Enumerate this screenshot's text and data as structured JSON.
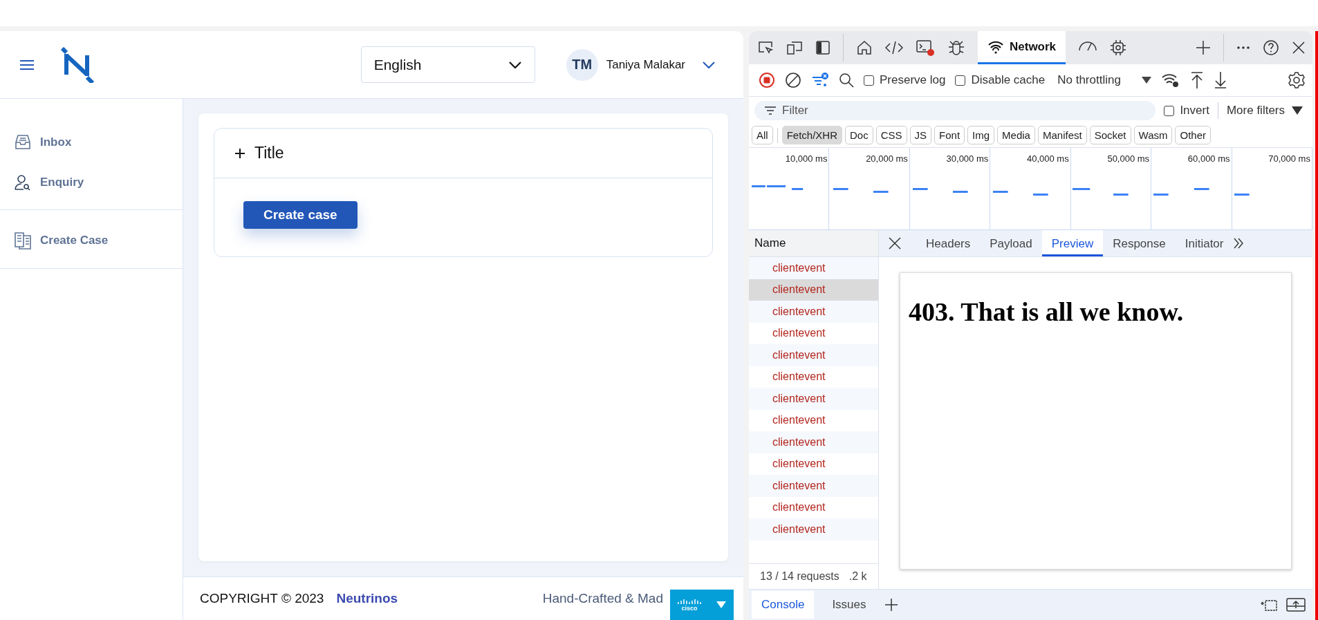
{
  "app": {
    "header": {
      "language_select": {
        "value": "English"
      },
      "user": {
        "initials": "TM",
        "name": "Taniya Malakar"
      }
    },
    "sidebar": {
      "sections": [
        {
          "items": [
            {
              "label": "Inbox"
            },
            {
              "label": "Enquiry"
            }
          ]
        },
        {
          "items": [
            {
              "label": "Create Case"
            }
          ]
        }
      ]
    },
    "card": {
      "panel_title": "Title",
      "button": "Create case"
    },
    "footer": {
      "copyright": "COPYRIGHT © 2023",
      "brand": "Neutrinos",
      "tagline": "Hand-Crafted & Mad"
    },
    "badge": {
      "logo_text": "cisco"
    }
  },
  "devtools": {
    "network_tab": {
      "label": "Network",
      "selected": true
    },
    "toolbar": {
      "preserve_log": {
        "label": "Preserve log",
        "checked": false
      },
      "disable_cache": {
        "label": "Disable cache",
        "checked": false
      },
      "throttling": "No throttling"
    },
    "filter": {
      "placeholder": "Filter",
      "invert": {
        "label": "Invert",
        "checked": false
      },
      "more_filters": "More filters"
    },
    "type_filters": [
      {
        "label": "All",
        "selected": false
      },
      {
        "label": "Fetch/XHR",
        "selected": true
      },
      {
        "label": "Doc",
        "selected": false
      },
      {
        "label": "CSS",
        "selected": false
      },
      {
        "label": "JS",
        "selected": false
      },
      {
        "label": "Font",
        "selected": false
      },
      {
        "label": "Img",
        "selected": false
      },
      {
        "label": "Media",
        "selected": false
      },
      {
        "label": "Manifest",
        "selected": false
      },
      {
        "label": "Socket",
        "selected": false
      },
      {
        "label": "Wasm",
        "selected": false
      },
      {
        "label": "Other",
        "selected": false
      }
    ],
    "timeline": {
      "ticks": [
        "10,000 ms",
        "20,000 ms",
        "30,000 ms",
        "40,000 ms",
        "50,000 ms",
        "60,000 ms",
        "70,000 ms"
      ]
    },
    "requests": {
      "column": "Name",
      "rows": [
        {
          "name": "clientevent",
          "selected": false
        },
        {
          "name": "clientevent",
          "selected": true
        },
        {
          "name": "clientevent",
          "selected": false
        },
        {
          "name": "clientevent",
          "selected": false
        },
        {
          "name": "clientevent",
          "selected": false
        },
        {
          "name": "clientevent",
          "selected": false
        },
        {
          "name": "clientevent",
          "selected": false
        },
        {
          "name": "clientevent",
          "selected": false
        },
        {
          "name": "clientevent",
          "selected": false
        },
        {
          "name": "clientevent",
          "selected": false
        },
        {
          "name": "clientevent",
          "selected": false
        },
        {
          "name": "clientevent",
          "selected": false
        },
        {
          "name": "clientevent",
          "selected": false
        }
      ],
      "status": "13 / 14 requests",
      "transfer": ".2 k"
    },
    "detail_tabs": [
      {
        "label": "Headers",
        "selected": false
      },
      {
        "label": "Payload",
        "selected": false
      },
      {
        "label": "Preview",
        "selected": true
      },
      {
        "label": "Response",
        "selected": false
      },
      {
        "label": "Initiator",
        "selected": false
      }
    ],
    "preview": {
      "heading": "403. That is all we know."
    },
    "drawer_tabs": [
      {
        "label": "Console",
        "selected": true
      },
      {
        "label": "Issues",
        "selected": false
      }
    ]
  }
}
